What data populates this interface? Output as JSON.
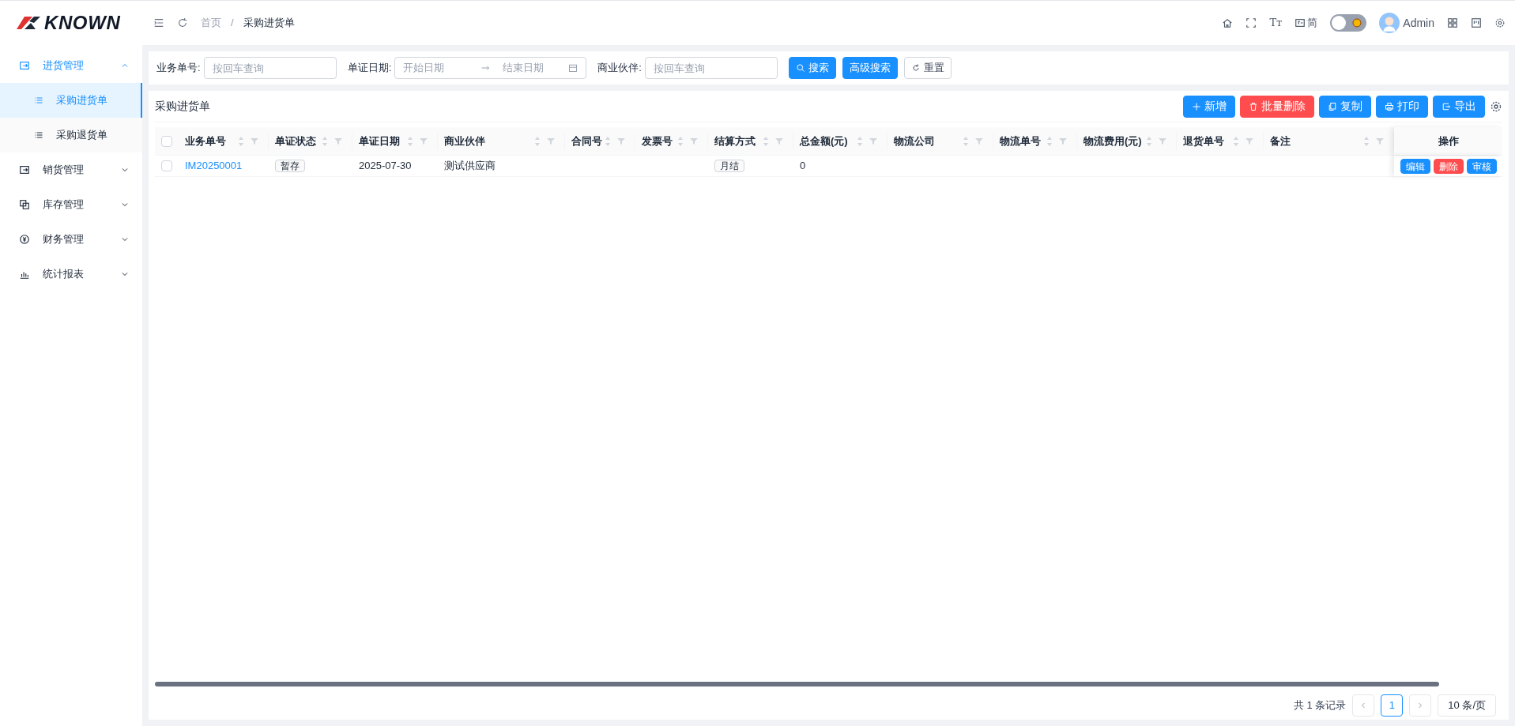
{
  "header": {
    "logo": "KNOWN",
    "breadcrumb": [
      "首页",
      "采购进货单"
    ],
    "breadcrumb_separator": "/",
    "font_button": "Tт",
    "lang_button": "简",
    "theme_switch": {
      "on": false
    },
    "user": "Admin"
  },
  "sidebar": {
    "items": [
      {
        "label": "进货管理",
        "kind": "in",
        "expanded": true,
        "selected": true,
        "children": [
          {
            "label": "采购进货单",
            "selected": true
          },
          {
            "label": "采购退货单",
            "selected": false
          }
        ]
      },
      {
        "label": "销货管理",
        "kind": "out",
        "expanded": false,
        "selected": false
      },
      {
        "label": "库存管理",
        "kind": "stock",
        "expanded": false,
        "selected": false
      },
      {
        "label": "财务管理",
        "kind": "money",
        "expanded": false,
        "selected": false
      },
      {
        "label": "统计报表",
        "kind": "chart",
        "expanded": false,
        "selected": false
      }
    ]
  },
  "search": {
    "fields": [
      {
        "label": "业务单号:",
        "kind": "text",
        "placeholder": "按回车查询"
      },
      {
        "label": "单证日期:",
        "kind": "range",
        "placeholder": "开始日期",
        "placeholder_end": "结束日期"
      },
      {
        "label": "商业伙伴:",
        "kind": "text",
        "placeholder": "按回车查询"
      }
    ],
    "buttons": [
      {
        "label": "搜索",
        "kind": "primary"
      },
      {
        "label": "高级搜索",
        "kind": "primary"
      },
      {
        "label": "重置",
        "kind": "default"
      }
    ]
  },
  "table": {
    "title": "采购进货单",
    "toolbar": [
      {
        "label": "新增",
        "kind": "add"
      },
      {
        "label": "批量删除",
        "kind": "delete"
      },
      {
        "label": "复制",
        "kind": "copy"
      },
      {
        "label": "打印",
        "kind": "print"
      },
      {
        "label": "导出",
        "kind": "export"
      }
    ],
    "all_checked": false,
    "columns": [
      "业务单号",
      "单证状态",
      "单证日期",
      "商业伙伴",
      "合同号",
      "发票号",
      "结算方式",
      "总金额(元)",
      "物流公司",
      "物流单号",
      "物流费用(元)",
      "退货单号",
      "备注"
    ],
    "action_column": "操作",
    "rows": [
      {
        "checked": false,
        "cells": [
          {
            "text": "IM20250001",
            "kind": "link"
          },
          {
            "text": "暂存",
            "kind": "tag"
          },
          {
            "text": "2025-07-30",
            "kind": "text"
          },
          {
            "text": "测试供应商",
            "kind": "text"
          },
          null,
          null,
          {
            "text": "月结",
            "kind": "tag"
          },
          {
            "text": "0",
            "kind": "text"
          }
        ],
        "actions": [
          {
            "label": "编辑",
            "kind": "primary"
          },
          {
            "label": "删除",
            "kind": "danger"
          },
          {
            "label": "审核",
            "kind": "primary"
          }
        ]
      }
    ]
  },
  "pagination": {
    "total": "共 1 条记录",
    "pages": [
      {
        "label": "1",
        "selected": true
      }
    ],
    "page_size": "10 条/页"
  }
}
